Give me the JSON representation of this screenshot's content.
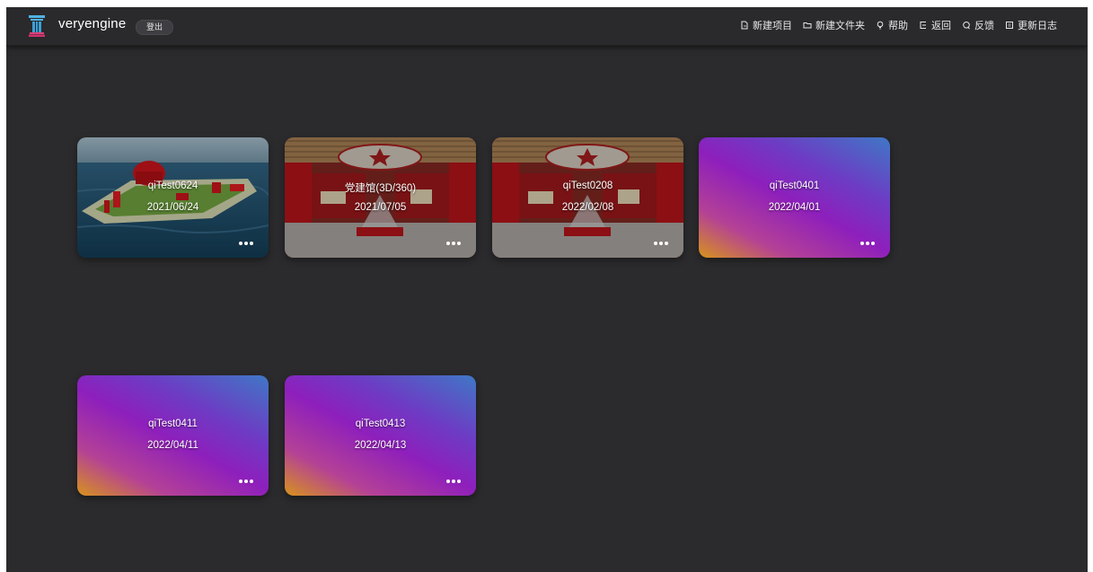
{
  "app": {
    "brand": "veryengine",
    "logout_label": "登出"
  },
  "nav": [
    {
      "label": "新建项目",
      "icon": "file-icon"
    },
    {
      "label": "新建文件夹",
      "icon": "folder-icon"
    },
    {
      "label": "帮助",
      "icon": "bulb-icon"
    },
    {
      "label": "返回",
      "icon": "return-icon"
    },
    {
      "label": "反馈",
      "icon": "chat-icon"
    },
    {
      "label": "更新日志",
      "icon": "log-icon"
    }
  ],
  "projects": [
    {
      "name": "qiTest0624",
      "date": "2021/06/24",
      "thumb": "island-scene"
    },
    {
      "name": "党建馆(3D/360)",
      "date": "2021/07/05",
      "thumb": "exhibition-hall"
    },
    {
      "name": "qiTest0208",
      "date": "2022/02/08",
      "thumb": "exhibition-hall"
    },
    {
      "name": "qiTest0401",
      "date": "2022/04/01",
      "thumb": "gradient"
    },
    {
      "name": "qiTest0411",
      "date": "2022/04/11",
      "thumb": "gradient"
    },
    {
      "name": "qiTest0413",
      "date": "2022/04/13",
      "thumb": "gradient"
    }
  ],
  "colors": {
    "background": "#2b2b2d",
    "topbar": "#2a2a2c",
    "gradient_start": "#d7931c",
    "gradient_mid": "#8e1fbc",
    "gradient_end": "#3f78c6"
  }
}
